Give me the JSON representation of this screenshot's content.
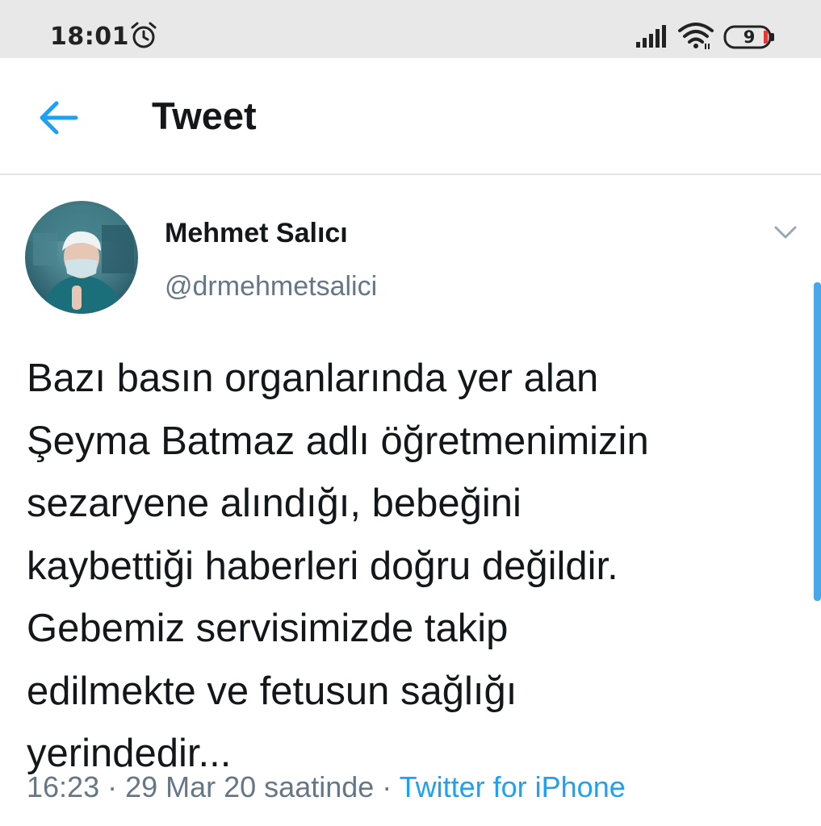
{
  "status_bar": {
    "time": "18:01",
    "battery_level": "9",
    "icons": [
      "alarm-icon",
      "signal-icon",
      "wifi-icon",
      "battery-icon"
    ]
  },
  "header": {
    "title": "Tweet",
    "back_icon": "arrow-left-icon"
  },
  "tweet": {
    "author_name": "Mehmet Salıcı",
    "author_handle": "@drmehmetsalici",
    "text": "Bazı basın organlarında yer alan\nŞeyma Batmaz adlı öğretmenimizin\nsezaryene alındığı, bebeğini\nkaybettiği haberleri doğru değildir.\nGebemiz servisimizde takip\nedilmekte ve fetusun sağlığı\nyerindedir...",
    "timestamp": "16:23 · 29 Mar 20 saatinde · ",
    "source": "Twitter for iPhone"
  },
  "colors": {
    "accent": "#1da1f2",
    "secondary_text": "#657786",
    "primary_text": "#14171a",
    "status_bar_bg": "#e8e8e8",
    "scrollbar": "#4aa8e8"
  }
}
